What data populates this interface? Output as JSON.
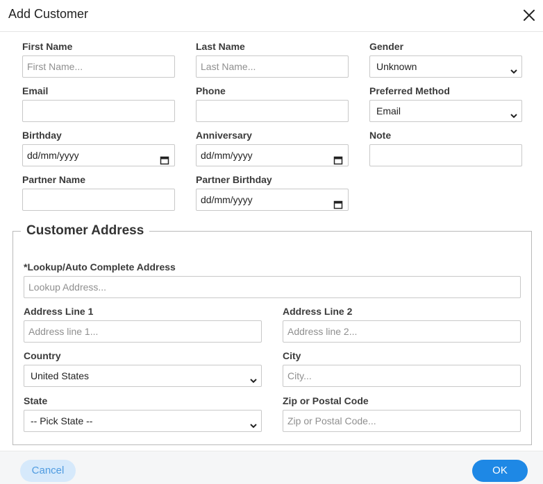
{
  "dialog": {
    "title": "Add Customer",
    "close_icon": "close-icon"
  },
  "fields": {
    "first_name": {
      "label": "First Name",
      "placeholder": "First Name..."
    },
    "last_name": {
      "label": "Last Name",
      "placeholder": "Last Name..."
    },
    "gender": {
      "label": "Gender",
      "value": "Unknown"
    },
    "email": {
      "label": "Email",
      "value": ""
    },
    "phone": {
      "label": "Phone",
      "value": ""
    },
    "preferred_method": {
      "label": "Preferred Method",
      "value": "Email"
    },
    "birthday": {
      "label": "Birthday",
      "value": "dd/mm/yyyy"
    },
    "anniversary": {
      "label": "Anniversary",
      "value": "dd/mm/yyyy"
    },
    "note": {
      "label": "Note",
      "value": ""
    },
    "partner_name": {
      "label": "Partner Name",
      "value": ""
    },
    "partner_birthday": {
      "label": "Partner Birthday",
      "value": "dd/mm/yyyy"
    }
  },
  "address": {
    "legend": "Customer Address",
    "lookup": {
      "label": "*Lookup/Auto Complete Address",
      "placeholder": "Lookup Address..."
    },
    "line1": {
      "label": "Address Line 1",
      "placeholder": "Address line 1..."
    },
    "line2": {
      "label": "Address Line 2",
      "placeholder": "Address line 2..."
    },
    "country": {
      "label": "Country",
      "value": "United States"
    },
    "city": {
      "label": "City",
      "placeholder": "City..."
    },
    "state": {
      "label": "State",
      "value": "-- Pick State --"
    },
    "zip": {
      "label": "Zip or Postal Code",
      "placeholder": "Zip or Postal Code..."
    }
  },
  "footer": {
    "cancel_label": "Cancel",
    "ok_label": "OK"
  },
  "colors": {
    "primary": "#1e88e5",
    "cancel_bg": "#d6e9fb",
    "cancel_text": "#4f9be0"
  }
}
